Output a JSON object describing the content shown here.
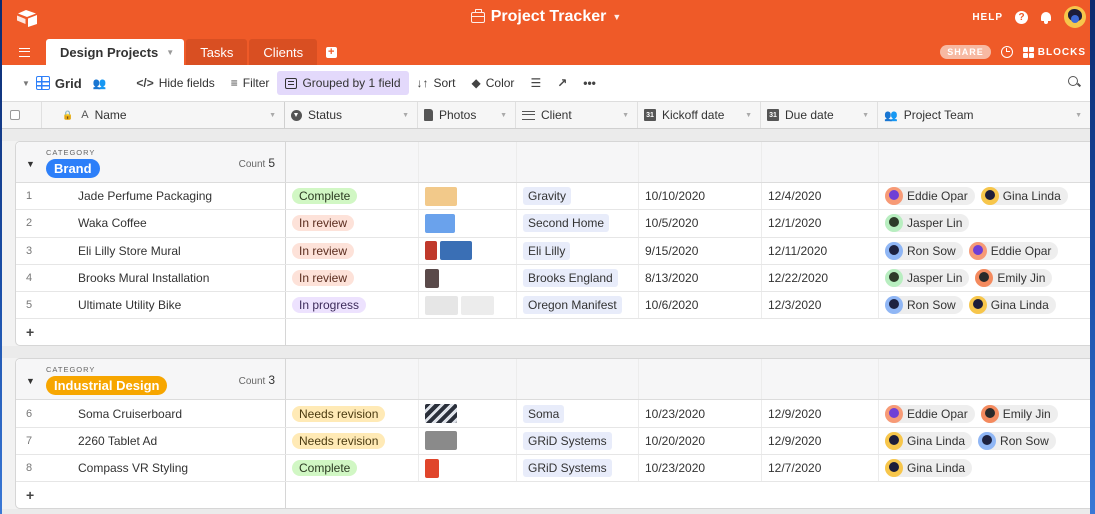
{
  "app": {
    "title": "Project Tracker",
    "help_label": "HELP",
    "help_icon": "?",
    "share_label": "SHARE",
    "blocks_label": "BLOCKS",
    "brand_color": "#ef5a28"
  },
  "tabs": [
    {
      "label": "Design Projects",
      "active": true
    },
    {
      "label": "Tasks",
      "active": false
    },
    {
      "label": "Clients",
      "active": false
    }
  ],
  "add_tab_icon": "+",
  "toolbar": {
    "view_label": "Grid",
    "hide_fields": "Hide fields",
    "filter": "Filter",
    "grouped": "Grouped by 1 field",
    "sort": "Sort",
    "color": "Color",
    "more": "•••"
  },
  "columns": {
    "name": "Name",
    "status": "Status",
    "photos": "Photos",
    "client": "Client",
    "kickoff": "Kickoff date",
    "due": "Due date",
    "team": "Project Team",
    "cal_glyph": "31"
  },
  "status_colors": {
    "Complete": {
      "bg": "#d1f7c4",
      "fg": "#2c3a22"
    },
    "In review": {
      "bg": "#fde2d9",
      "fg": "#5a2c1e"
    },
    "In progress": {
      "bg": "#ede2fe",
      "fg": "#3c2a5a"
    },
    "Needs revision": {
      "bg": "#ffeab6",
      "fg": "#4a3a10"
    }
  },
  "people_colors": {
    "Eddie Opar": "#f79a76",
    "Gina Linda": "#f7c64b",
    "Jasper Lin": "#b8eec0",
    "Ron Sow": "#8fb6f5",
    "Emily Jin": "#f48a5e"
  },
  "groups": [
    {
      "label": "CATEGORY",
      "value": "Brand",
      "color": "#2d7ff9",
      "count_label": "Count",
      "count": "5",
      "add_icon": "+",
      "rows": [
        {
          "num": "1",
          "name": "Jade Perfume Packaging",
          "status": "Complete",
          "photos": [
            "#f2c98a"
          ],
          "client": "Gravity",
          "kickoff": "10/10/2020",
          "due": "12/4/2020",
          "team": [
            "Eddie Opar",
            "Gina Linda"
          ]
        },
        {
          "num": "2",
          "name": "Waka Coffee",
          "status": "In review",
          "photos": [
            "#6aa2ec"
          ],
          "client": "Second Home",
          "kickoff": "10/5/2020",
          "due": "12/1/2020",
          "team": [
            "Jasper Lin"
          ]
        },
        {
          "num": "3",
          "name": "Eli Lilly Store Mural",
          "status": "In review",
          "photos": [
            "#c0392b",
            "#3a6fb5"
          ],
          "client": "Eli Lilly",
          "kickoff": "9/15/2020",
          "due": "12/11/2020",
          "team": [
            "Ron Sow",
            "Eddie Opar"
          ]
        },
        {
          "num": "4",
          "name": "Brooks Mural Installation",
          "status": "In review",
          "photos": [
            "#5a4a4a"
          ],
          "client": "Brooks England",
          "kickoff": "8/13/2020",
          "due": "12/22/2020",
          "team": [
            "Jasper Lin",
            "Emily Jin"
          ]
        },
        {
          "num": "5",
          "name": "Ultimate Utility Bike",
          "status": "In progress",
          "photos": [
            "#e6e6e6",
            "#ececec"
          ],
          "client": "Oregon Manifest",
          "kickoff": "10/6/2020",
          "due": "12/3/2020",
          "team": [
            "Ron Sow",
            "Gina Linda"
          ]
        }
      ]
    },
    {
      "label": "CATEGORY",
      "value": "Industrial Design",
      "color": "#f7a600",
      "count_label": "Count",
      "count": "3",
      "add_icon": "+",
      "rows": [
        {
          "num": "6",
          "name": "Soma Cruiserboard",
          "status": "Needs revision",
          "photos": [
            "#2a2f3a"
          ],
          "client": "Soma",
          "kickoff": "10/23/2020",
          "due": "12/9/2020",
          "team": [
            "Eddie Opar",
            "Emily Jin"
          ]
        },
        {
          "num": "7",
          "name": "2260 Tablet Ad",
          "status": "Needs revision",
          "photos": [
            "#8a8a8a"
          ],
          "client": "GRiD Systems",
          "kickoff": "10/20/2020",
          "due": "12/9/2020",
          "team": [
            "Gina Linda",
            "Ron Sow"
          ]
        },
        {
          "num": "8",
          "name": "Compass VR Styling",
          "status": "Complete",
          "photos": [
            "#e0452b"
          ],
          "client": "GRiD Systems",
          "kickoff": "10/23/2020",
          "due": "12/7/2020",
          "team": [
            "Gina Linda"
          ]
        }
      ]
    }
  ]
}
